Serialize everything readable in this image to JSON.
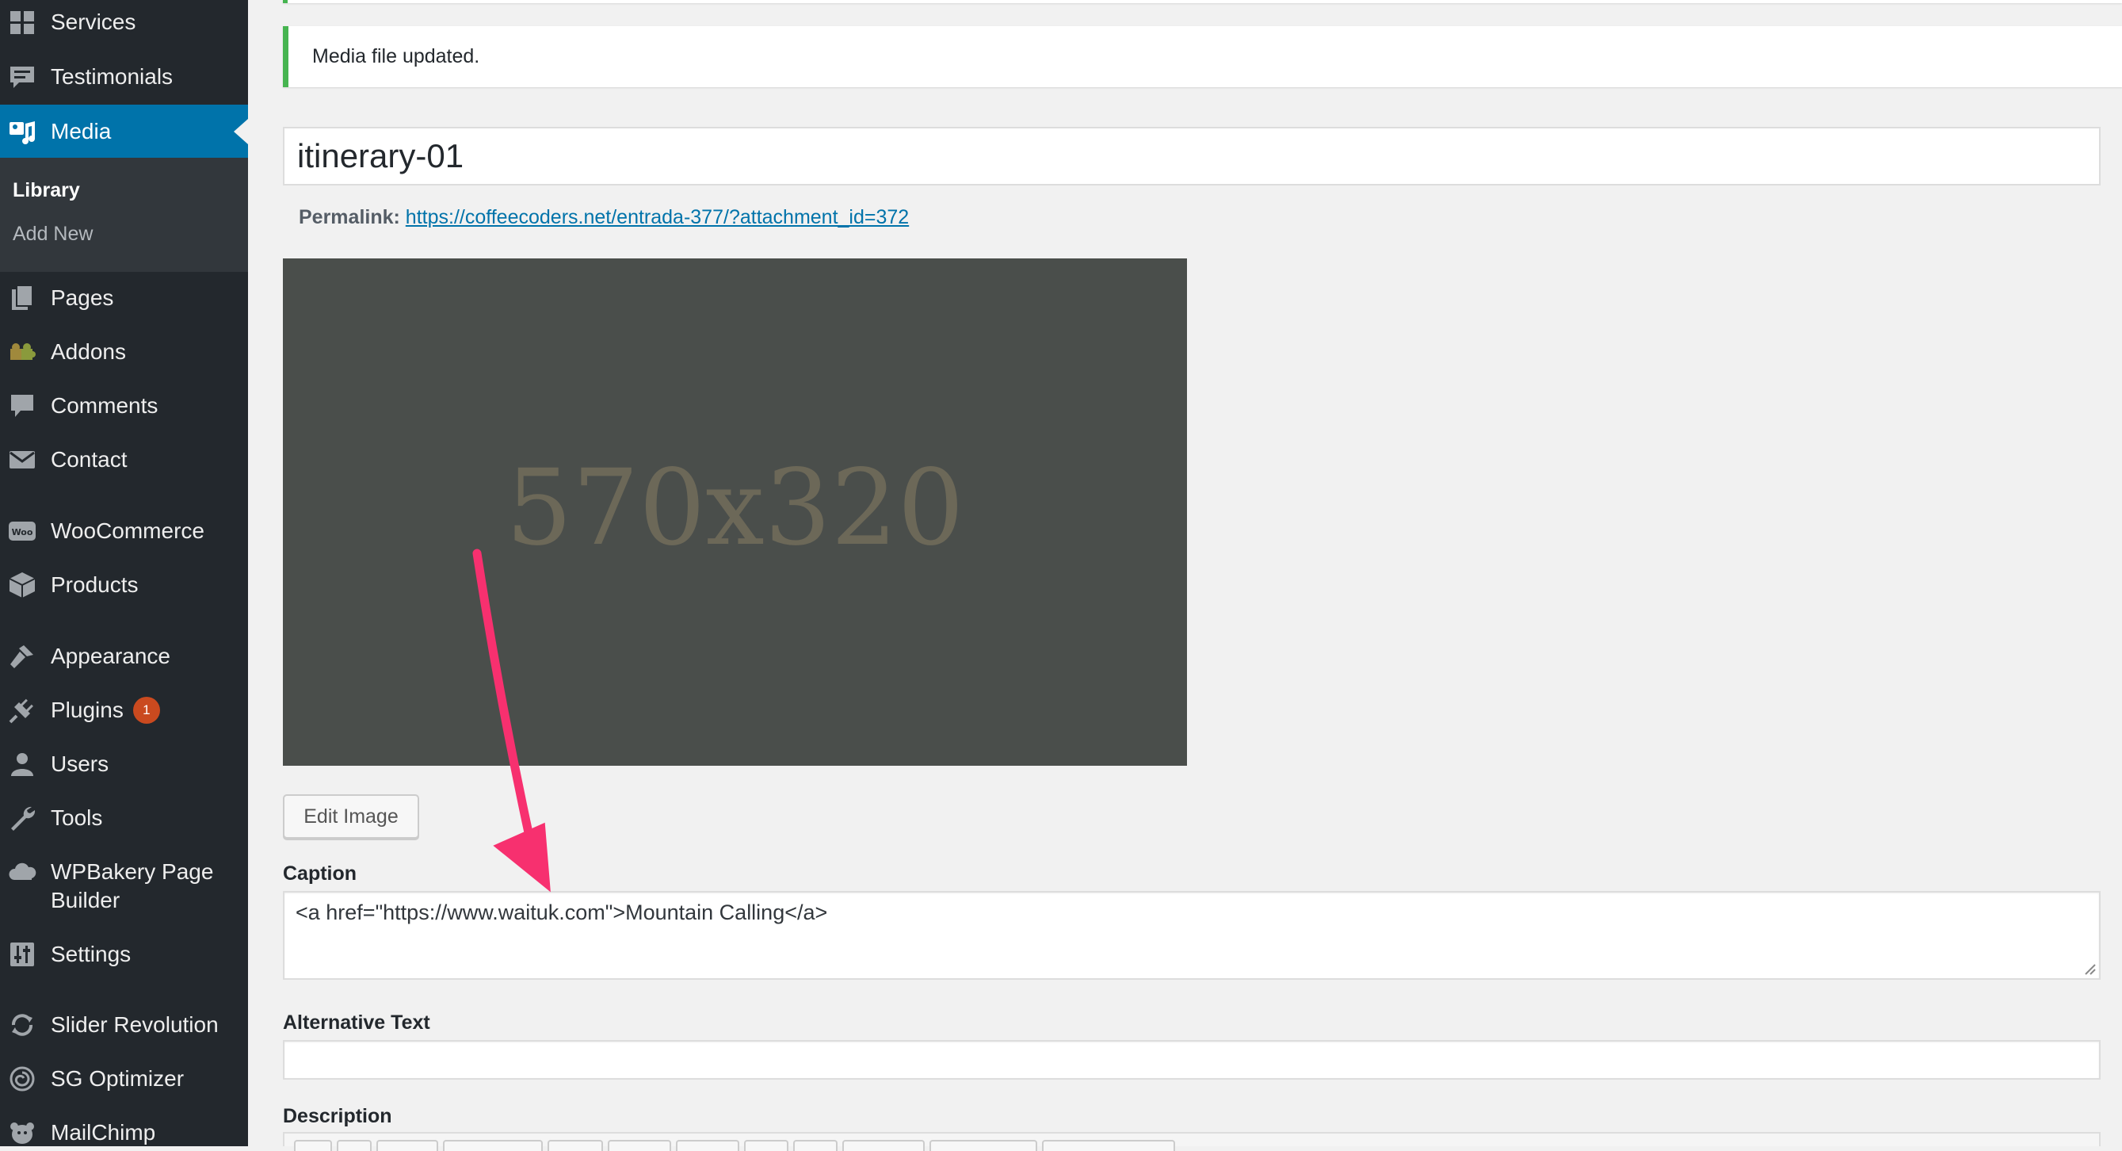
{
  "sidebar": {
    "items": [
      {
        "label": "Services",
        "icon": "grid-icon"
      },
      {
        "label": "Testimonials",
        "icon": "testimonial-icon"
      },
      {
        "label": "Media",
        "icon": "media-icon"
      },
      {
        "label": "Pages",
        "icon": "pages-icon"
      },
      {
        "label": "Addons",
        "icon": "puzzle-icon"
      },
      {
        "label": "Comments",
        "icon": "comment-icon"
      },
      {
        "label": "Contact",
        "icon": "mail-icon"
      },
      {
        "label": "WooCommerce",
        "icon": "woo-icon"
      },
      {
        "label": "Products",
        "icon": "box-icon"
      },
      {
        "label": "Appearance",
        "icon": "brush-icon"
      },
      {
        "label": "Plugins",
        "icon": "plug-icon",
        "badge": "1"
      },
      {
        "label": "Users",
        "icon": "user-icon"
      },
      {
        "label": "Tools",
        "icon": "wrench-icon"
      },
      {
        "label": "WPBakery Page",
        "label_line2": "Builder",
        "icon": "cloud-icon"
      },
      {
        "label": "Settings",
        "icon": "sliders-icon"
      },
      {
        "label": "Slider Revolution",
        "icon": "refresh-icon"
      },
      {
        "label": "SG Optimizer",
        "icon": "spiral-icon"
      },
      {
        "label": "MailChimp",
        "icon": "chimp-icon"
      }
    ],
    "submenu": [
      {
        "label": "Library"
      },
      {
        "label": "Add New"
      }
    ]
  },
  "notice": {
    "text": "Media file updated."
  },
  "title": {
    "value": "itinerary-01"
  },
  "permalink": {
    "label": "Permalink:",
    "url": "https://coffeecoders.net/entrada-377/?attachment_id=372"
  },
  "preview": {
    "placeholder_text": "570x320"
  },
  "edit_button": {
    "label": "Edit Image"
  },
  "caption": {
    "label": "Caption",
    "value": "<a href=\"https://www.waituk.com\">Mountain Calling</a>"
  },
  "alt_text": {
    "label": "Alternative Text",
    "value": ""
  },
  "description": {
    "label": "Description"
  },
  "colors": {
    "sidebar_bg": "#23282d",
    "active_bg": "#0073aa",
    "notice_border": "#46b450",
    "arrow": "#f7306f",
    "badge": "#ca4a1f"
  }
}
